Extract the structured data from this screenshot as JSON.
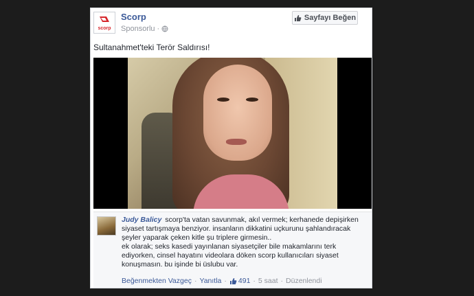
{
  "post": {
    "page_name": "Scorp",
    "sponsored": "Sponsorlu",
    "dot": "·",
    "like_page_button": "Sayfayı Beğen",
    "text": "Sultanahmet'teki Terör Saldırısı!",
    "logo_text": "scorp",
    "brand_color": "#d6262c"
  },
  "comment": {
    "author": "Judy Balicy",
    "lines": [
      "scorp'ta vatan savunmak, akıl vermek; kerhanede depişirken",
      "siyaset tartışmaya benziyor. insanların dikkatini uçkurunu şahlandıracak",
      "şeyler yaparak çeken kitle şu triplere girmesin..",
      "ek olarak; seks kasedi yayınlanan siyasetçiler bile makamlarını terk",
      "ediyorken, cinsel hayatını videolara döken scorp kullanıcıları siyaset",
      "konuşmasın. bu işinde bi üslubu var."
    ],
    "actions": {
      "unlike": "Beğenmekten Vazgeç",
      "reply": "Yanıtla",
      "like_count": "491",
      "time": "5 saat",
      "edited": "Düzenlendi",
      "sep": "·"
    }
  }
}
